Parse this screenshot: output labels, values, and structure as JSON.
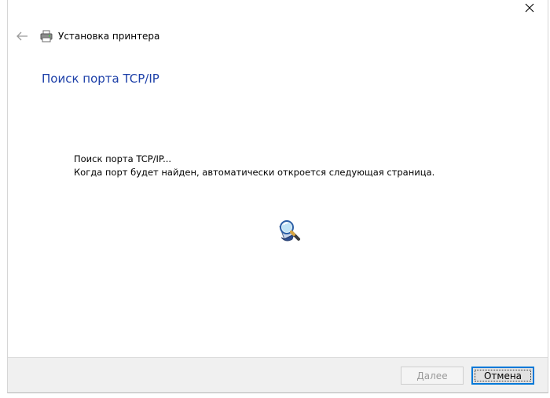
{
  "window": {
    "title": "Установка принтера",
    "back_icon": "back-arrow-icon",
    "close_icon": "close-icon",
    "printer_icon": "printer-icon"
  },
  "main": {
    "heading": "Поиск порта TCP/IP",
    "status_line1": "Поиск порта TCP/IP...",
    "status_line2": "Когда порт будет найден, автоматически откроется следующая страница.",
    "animation_icon": "search-magnifier-icon"
  },
  "footer": {
    "next_label": "Далее",
    "cancel_label": "Отмена"
  },
  "colors": {
    "heading": "#1c3fa8",
    "accent": "#0078d7"
  }
}
